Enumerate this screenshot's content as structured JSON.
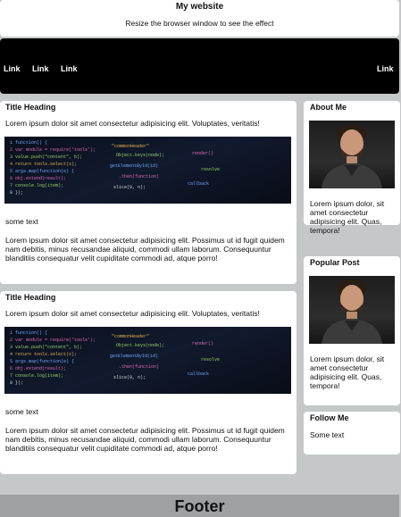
{
  "header": {
    "title": "My website",
    "subtitle": "Resize the browser window to see the effect"
  },
  "nav": {
    "links": [
      "Link",
      "Link",
      "Link"
    ],
    "right_link": "Link"
  },
  "posts": [
    {
      "title": "Title Heading",
      "intro": "Lorem ipsum dolor sit amet consectetur adipisicing elit. Voluptates, veritatis!",
      "caption": "some text",
      "body": "Lorem ipsum dolor sit amet consectetur adipisicing elit. Possimus ut id fugit quidem nam debitis, minus recusandae aliquid, commodi ullam laborum. Consequuntur blanditiis consequatur velit cupiditate commodi ad, atque porro!"
    },
    {
      "title": "Title Heading",
      "intro": "Lorem ipsum dolor sit amet consectetur adipisicing elit. Voluptates, veritatis!",
      "caption": "some text",
      "body": "Lorem ipsum dolor sit amet consectetur adipisicing elit. Possimus ut id fugit quidem nam debitis, minus recusandae aliquid, commodi ullam laborum. Consequuntur blanditiis consequatur velit cupiditate commodi ad, atque porro!"
    }
  ],
  "sidebar": {
    "about": {
      "title": "About Me",
      "text": "Lorem ipsum dolor, sit amet consectetur adipisicing elit. Quas, tempora!"
    },
    "popular": {
      "title": "Popular Post",
      "text": "Lorem ipsum dolor, sit amet consectetur adipisicing elit. Quas, tempora!"
    },
    "follow": {
      "title": "Follow Me",
      "text": "Some text"
    }
  },
  "footer": {
    "label": "Footer"
  },
  "colors": {
    "page_bg": "#c5c8c9",
    "navbar_bg": "#000000",
    "footer_bg": "#9ea0a2",
    "card_bg": "#ffffff"
  }
}
